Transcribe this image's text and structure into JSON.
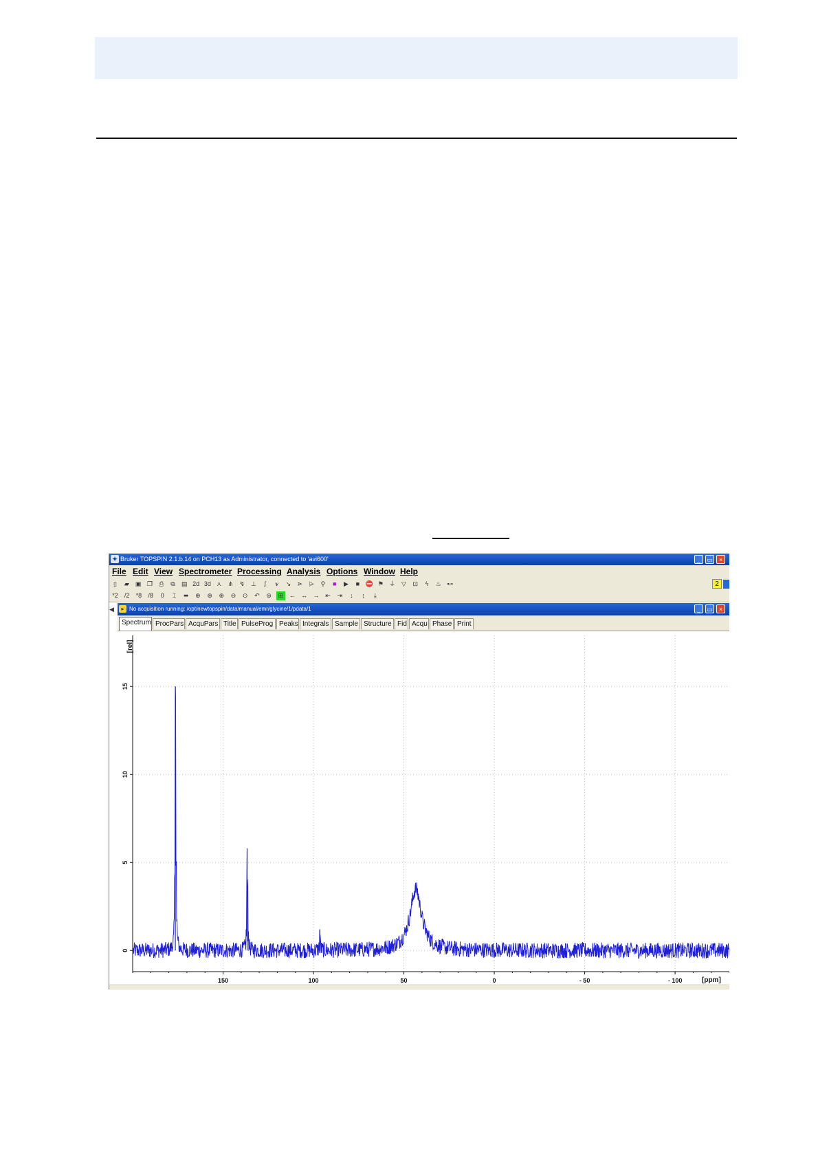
{
  "window": {
    "title": "Bruker TOPSPIN 2.1.b.14 on PCH13 as Administrator, connected to 'avi600'",
    "app_icon": "topspin-logo-icon",
    "accent_color": "#0a3fb0",
    "badge": "2"
  },
  "menu": [
    "File",
    "Edit",
    "View",
    "Spectrometer",
    "Processing",
    "Analysis",
    "Options",
    "Window",
    "Help"
  ],
  "toolbar1": [
    {
      "icon": "new-file-icon",
      "glyph": "▯"
    },
    {
      "icon": "open-folder-icon",
      "glyph": "▰"
    },
    {
      "icon": "save-icon",
      "glyph": "▣"
    },
    {
      "icon": "copy-icon",
      "glyph": "❐"
    },
    {
      "icon": "print-icon",
      "glyph": "⎙"
    },
    {
      "icon": "copy-data-icon",
      "glyph": "⧉"
    },
    {
      "icon": "paste-icon",
      "glyph": "▤"
    },
    {
      "icon": "2d-icon",
      "glyph": "2d"
    },
    {
      "icon": "3d-icon",
      "glyph": "3d"
    },
    {
      "icon": "spectrum-icon",
      "glyph": "⋏"
    },
    {
      "icon": "multiplot-icon",
      "glyph": "⋔"
    },
    {
      "icon": "phase-icon",
      "glyph": "↯"
    },
    {
      "icon": "baseline-icon",
      "glyph": "⊥"
    },
    {
      "icon": "integrate-icon",
      "glyph": "∫"
    },
    {
      "icon": "peak-pick-icon",
      "glyph": "⩛"
    },
    {
      "icon": "calibrate-icon",
      "glyph": "↘"
    },
    {
      "icon": "deconvolution-icon",
      "glyph": "⋗"
    },
    {
      "icon": "linewidth-icon",
      "glyph": "⩥"
    },
    {
      "icon": "multiplet-icon",
      "glyph": "⚲"
    },
    {
      "icon": "stop-square-icon",
      "glyph": "■"
    },
    {
      "icon": "play-icon",
      "glyph": "▶"
    },
    {
      "icon": "stop-icon",
      "glyph": "■"
    },
    {
      "icon": "halt-icon",
      "glyph": "⛔"
    },
    {
      "icon": "flag-icon",
      "glyph": "⚑"
    },
    {
      "icon": "filter-icon",
      "glyph": "⏚"
    },
    {
      "icon": "funnel-icon",
      "glyph": "▽"
    },
    {
      "icon": "frame-icon",
      "glyph": "⊡"
    },
    {
      "icon": "lightning-icon",
      "glyph": "ϟ"
    },
    {
      "icon": "temperature-icon",
      "glyph": "♨"
    },
    {
      "icon": "link-icon",
      "glyph": "⊷"
    }
  ],
  "toolbar2": [
    {
      "icon": "scale-times2-icon",
      "glyph": "*2"
    },
    {
      "icon": "scale-div2-icon",
      "glyph": "/2"
    },
    {
      "icon": "scale-times8-icon",
      "glyph": "*8"
    },
    {
      "icon": "scale-div8-icon",
      "glyph": "/8"
    },
    {
      "icon": "reset-zero-icon",
      "glyph": "0"
    },
    {
      "icon": "intensity-icon",
      "glyph": "⌶"
    },
    {
      "icon": "full-view-icon",
      "glyph": "⬌"
    },
    {
      "icon": "zoom-icon",
      "glyph": "⊕"
    },
    {
      "icon": "zoom-in-icon",
      "glyph": "⊕"
    },
    {
      "icon": "zoom-in-more-icon",
      "glyph": "⊕"
    },
    {
      "icon": "zoom-out-icon",
      "glyph": "⊖"
    },
    {
      "icon": "zoom-reset-icon",
      "glyph": "⊙"
    },
    {
      "icon": "undo-zoom-icon",
      "glyph": "↶"
    },
    {
      "icon": "zoom-region-icon",
      "glyph": "⊜"
    },
    {
      "icon": "grid-active-icon",
      "glyph": "⊞"
    },
    {
      "icon": "shift-left-icon",
      "glyph": "←"
    },
    {
      "icon": "shift-both-icon",
      "glyph": "↔"
    },
    {
      "icon": "shift-right-icon",
      "glyph": "→"
    },
    {
      "icon": "go-start-icon",
      "glyph": "⇤"
    },
    {
      "icon": "go-end-icon",
      "glyph": "⇥"
    },
    {
      "icon": "shift-down-icon",
      "glyph": "↓"
    },
    {
      "icon": "shift-updown-icon",
      "glyph": "↕"
    },
    {
      "icon": "shift-bottom-icon",
      "glyph": "⤓"
    }
  ],
  "dataset_bar": {
    "text": "No acquisition running: /opt/newtopspin/data/manual/emr/glycine/1/pdata/1",
    "icon": "dataset-folder-icon"
  },
  "tabs": [
    "Spectrum",
    "ProcPars",
    "AcquPars",
    "Title",
    "PulseProg",
    "Peaks",
    "Integrals",
    "Sample",
    "Structure",
    "Fid",
    "Acqu",
    "Phase",
    "Print"
  ],
  "active_tab": "Spectrum",
  "chart_data": {
    "type": "line",
    "title": "",
    "xlabel": "[ppm]",
    "ylabel": "[rel]",
    "xlim": [
      200,
      -130
    ],
    "ylim": [
      -1.2,
      17.9
    ],
    "x_reversed": true,
    "x_ticks": [
      150,
      100,
      50,
      0,
      -50,
      -100
    ],
    "x_tick_labels": [
      "150",
      "100",
      "50",
      "0",
      "- 50",
      "- 100"
    ],
    "y_ticks": [
      0,
      5,
      10,
      15
    ],
    "y_tick_labels": [
      "0",
      "5",
      "10",
      "15"
    ],
    "grid": true,
    "line_color": "#1f1fd6",
    "baseline": 0,
    "noise_amplitude": 0.45,
    "series": [
      {
        "peaks": [
          {
            "x": 176.4,
            "height": 15.0,
            "width": 0.25
          },
          {
            "x": 136.7,
            "height": 5.8,
            "width": 0.25
          },
          {
            "x": 96.5,
            "height": 1.2,
            "width": 0.2
          },
          {
            "x": 43.5,
            "height": 3.5,
            "width": 3.8
          }
        ]
      }
    ]
  }
}
